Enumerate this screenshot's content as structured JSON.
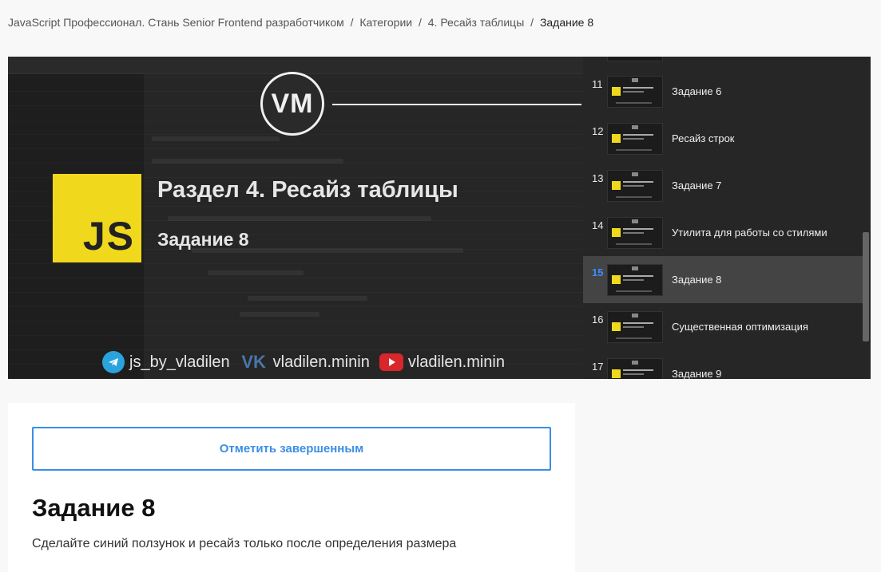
{
  "breadcrumb": {
    "items": [
      "JavaScript Профессионал. Стань Senior Frontend разработчиком",
      "Категории",
      "4. Ресайз таблицы"
    ],
    "separator": "/",
    "current": "Задание 8"
  },
  "video": {
    "logo_text": "VM",
    "js_badge": "JS",
    "title": "Раздел 4. Ресайз таблицы",
    "subtitle": "Задание 8",
    "socials": {
      "telegram": "js_by_vladilen",
      "vk": "vladilen.minin",
      "youtube": "vladilen.minin"
    }
  },
  "playlist": {
    "active_index": 4,
    "items": [
      {
        "num": "11",
        "title": "Задание 6"
      },
      {
        "num": "12",
        "title": "Ресайз строк"
      },
      {
        "num": "13",
        "title": "Задание 7"
      },
      {
        "num": "14",
        "title": "Утилита для работы со стилями"
      },
      {
        "num": "15",
        "title": "Задание 8"
      },
      {
        "num": "16",
        "title": "Существенная оптимизация"
      },
      {
        "num": "17",
        "title": "Задание 9"
      }
    ]
  },
  "lesson": {
    "complete_button": "Отметить завершенным",
    "title": "Задание 8",
    "description": "Сделайте синий ползунок и ресайз только после определения размера"
  },
  "colors": {
    "accent": "#3a8ee6",
    "active_number": "#3a8eff",
    "js_yellow": "#f0d91c"
  }
}
